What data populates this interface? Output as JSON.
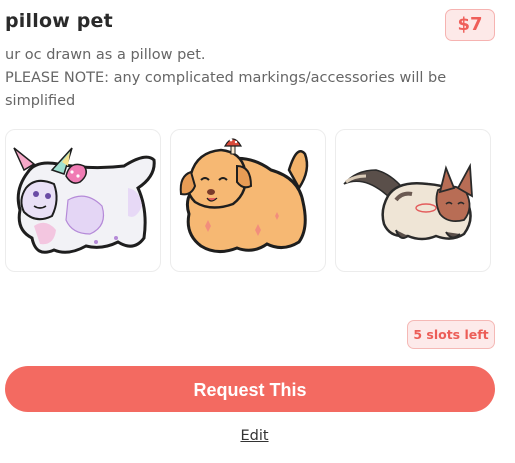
{
  "listing": {
    "title": "pillow pet",
    "price": "$7",
    "description_lines": [
      "ur oc drawn as a pillow pet.",
      "PLEASE NOTE: any complicated markings/accessories will be",
      "simplified"
    ],
    "slots_badge": "5 slots left",
    "request_button": "Request This",
    "edit_link": "Edit"
  },
  "thumbnails": [
    {
      "subject": "white pastel unicorn pillow pet with rainbow horns and pink bow"
    },
    {
      "subject": "orange fluffy dog pillow pet with mushroom on head"
    },
    {
      "subject": "cream and brown cat pillow pet with dark tail"
    }
  ],
  "colors": {
    "accent": "#f36a61",
    "price_text": "#ef5f5a",
    "badge_bg": "#fde9e8"
  }
}
